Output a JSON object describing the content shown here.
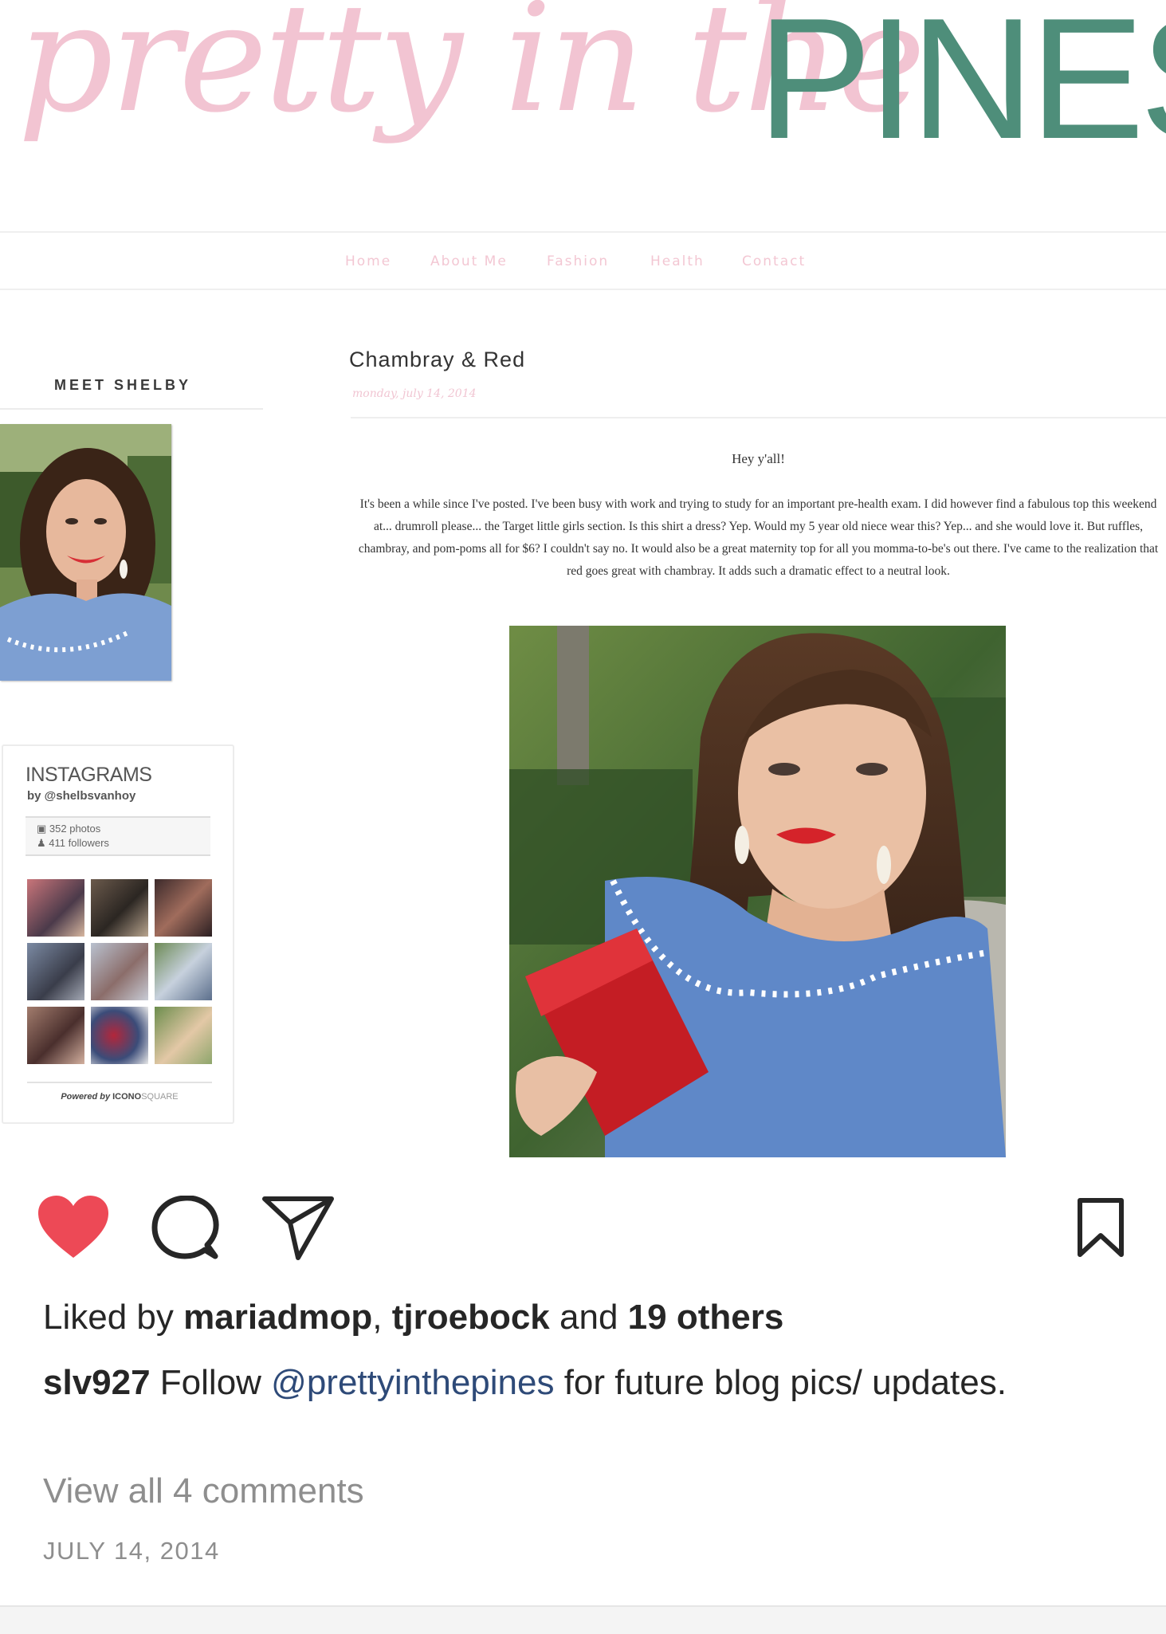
{
  "blog": {
    "title_script": "pretty in the",
    "title_caps": "PINES",
    "colors": {
      "pink": "#f2c4d2",
      "green": "#4e8e7a",
      "nav_pink": "#f3c7d3"
    },
    "nav": [
      "Home",
      "About Me",
      "Fashion",
      "Health",
      "Contact"
    ],
    "sidebar_heading": "MEET SHELBY",
    "instagram_widget": {
      "title": "INSTAGRAMS",
      "by": "by @shelbsvanhoy",
      "photos": "352 photos",
      "followers": "411 followers",
      "powered_prefix": "Powered by ",
      "powered_brand": "ICONO",
      "powered_suffix": "SQUARE"
    },
    "post": {
      "title": "Chambray & Red",
      "date": "monday, july 14, 2014",
      "greeting": "Hey y'all!",
      "body": "It's been a while since I've posted.  I've been busy with work and trying to study for an important pre-health exam.  I did however find a fabulous top this weekend at... drumroll please... the Target little girls section.  Is this shirt a dress? Yep.  Would my 5 year old niece wear this? Yep... and she would love it.  But ruffles, chambray, and pom-poms all for $6? I couldn't say no.  It would also be a great maternity top for all you momma-to-be's out there.  I've came to the realization that red goes great with chambray.  It adds such a dramatic effect to a neutral look."
    }
  },
  "instagram": {
    "liked_by_prefix": "Liked by ",
    "liker1": "mariadmop",
    "separator": ", ",
    "liker2": "tjroebock",
    "and_text": " and ",
    "others": "19 others",
    "caption_user": "slv927",
    "caption_pre": " Follow ",
    "caption_mention": "@prettyinthepines",
    "caption_post": " for future blog pics/ updates.",
    "view_comments": "View all 4 comments",
    "date": "JULY 14, 2014",
    "icons": [
      "heart-icon",
      "comment-icon",
      "share-icon",
      "bookmark-icon"
    ],
    "liked": true,
    "heart_color": "#ed4956"
  }
}
